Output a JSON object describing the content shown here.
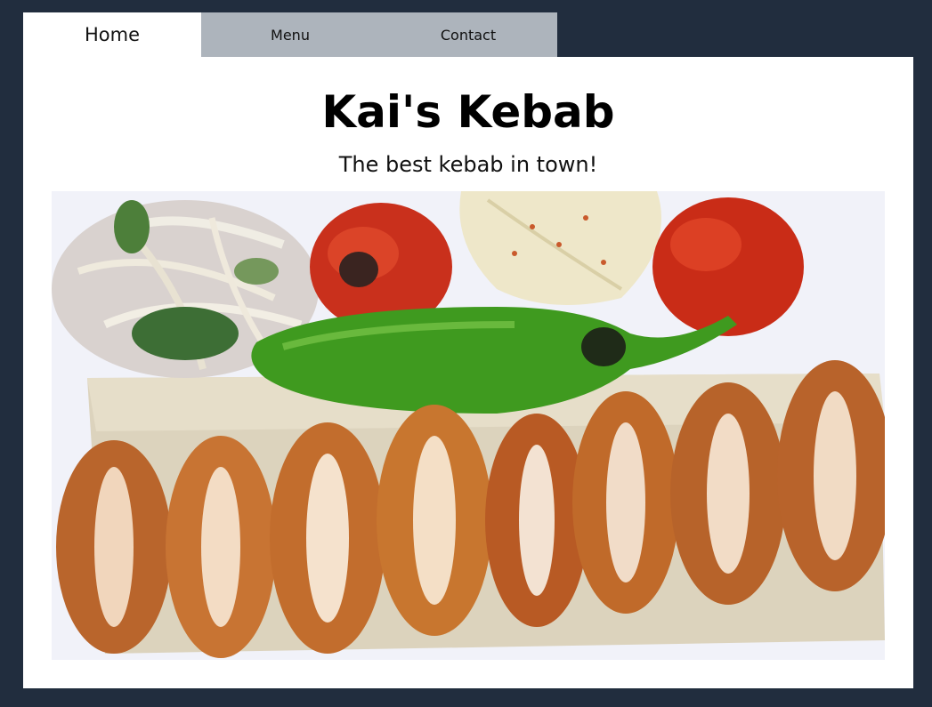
{
  "nav": {
    "tabs": [
      {
        "label": "Home",
        "active": true
      },
      {
        "label": "Menu",
        "active": false
      },
      {
        "label": "Contact",
        "active": false
      }
    ]
  },
  "hero": {
    "title": "Kai's Kebab",
    "subtitle": "The best kebab in town!"
  },
  "colors": {
    "page_background": "#212d3e",
    "tab_inactive": "#adb4bc",
    "panel": "#ffffff"
  }
}
